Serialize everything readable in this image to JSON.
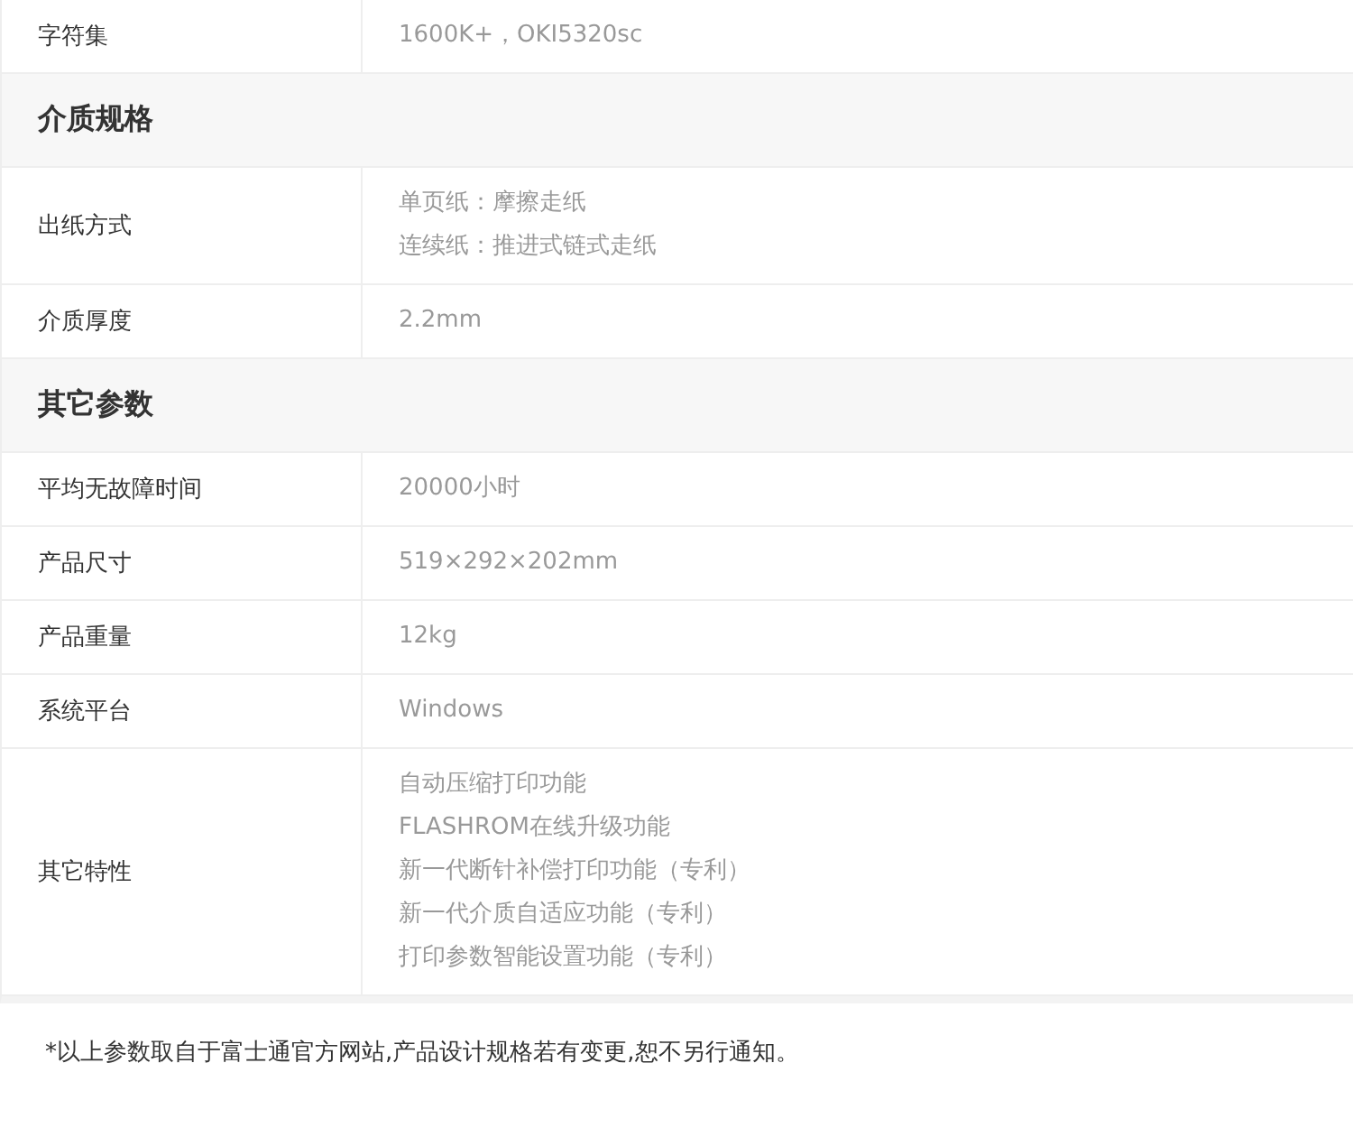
{
  "rows": [
    {
      "kind": "row",
      "label": "字符集",
      "values": [
        "1600K+，OKI5320sc"
      ]
    },
    {
      "kind": "section",
      "label": "介质规格"
    },
    {
      "kind": "row",
      "label": "出纸方式",
      "values": [
        "单页纸：摩擦走纸",
        "连续纸：推进式链式走纸"
      ]
    },
    {
      "kind": "row",
      "label": "介质厚度",
      "values": [
        "2.2mm"
      ]
    },
    {
      "kind": "section",
      "label": "其它参数"
    },
    {
      "kind": "row",
      "label": "平均无故障时间",
      "values": [
        "20000小时"
      ]
    },
    {
      "kind": "row",
      "label": "产品尺寸",
      "values": [
        "519×292×202mm"
      ]
    },
    {
      "kind": "row",
      "label": "产品重量",
      "values": [
        "12kg"
      ]
    },
    {
      "kind": "row",
      "label": "系统平台",
      "values": [
        "Windows"
      ]
    },
    {
      "kind": "row",
      "label": "其它特性",
      "values": [
        "自动压缩打印功能",
        "FLASHROM在线升级功能",
        "新一代断针补偿打印功能（专利）",
        "新一代介质自适应功能（专利）",
        "打印参数智能设置功能（专利）"
      ]
    }
  ],
  "footnote": "*以上参数取自于富士通官方网站,产品设计规格若有变更,恕不另行通知。"
}
